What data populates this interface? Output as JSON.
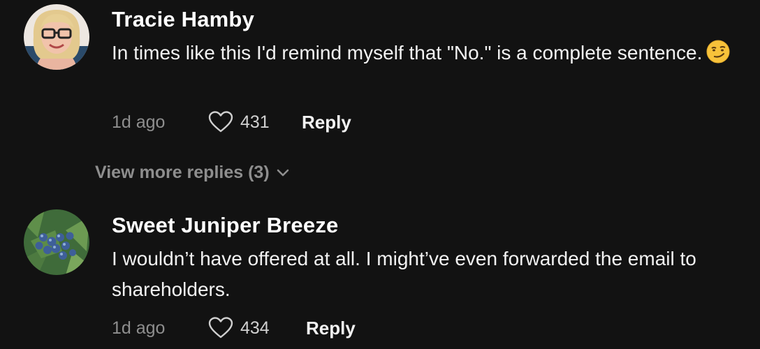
{
  "comments": [
    {
      "author": "Tracie Hamby",
      "text": "In times like this I'd remind myself that \"No.\" is a complete sentence.",
      "emoji": "smirking-face",
      "time": "1d ago",
      "likes": "431",
      "reply_label": "Reply"
    },
    {
      "author": "Sweet Juniper Breeze",
      "text": "I wouldn’t have offered at all. I might’ve even forwarded the email to shareholders.",
      "time": "1d ago",
      "likes": "434",
      "reply_label": "Reply"
    }
  ],
  "view_more_label": "View more replies (3)",
  "colors": {
    "background": "#121212",
    "muted_text": "#8e8e8e",
    "primary_text": "#ffffff"
  }
}
